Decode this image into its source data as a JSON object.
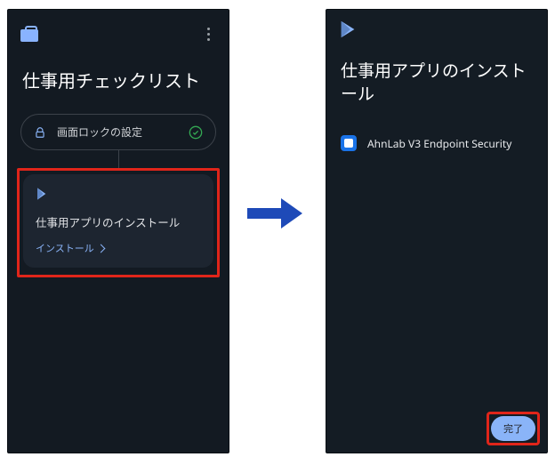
{
  "left": {
    "title": "仕事用チェックリスト",
    "chip_label": "画面ロックの設定",
    "card_title": "仕事用アプリのインストール",
    "card_action": "インストール"
  },
  "right": {
    "title": "仕事用アプリのインストール",
    "app_name": "AhnLab V3 Endpoint Security",
    "done_label": "完了"
  }
}
